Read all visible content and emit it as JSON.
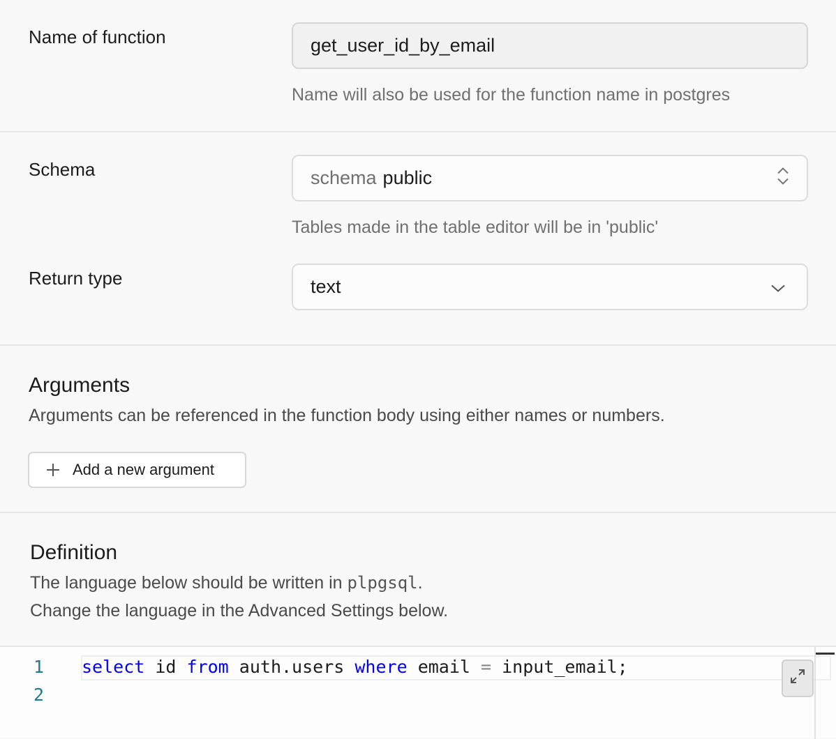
{
  "name_section": {
    "label": "Name of function",
    "value": "get_user_id_by_email",
    "help": "Name will also be used for the function name in postgres"
  },
  "schema_section": {
    "label": "Schema",
    "prefix": "schema",
    "value": "public",
    "help": "Tables made in the table editor will be in 'public'"
  },
  "return_section": {
    "label": "Return type",
    "value": "text"
  },
  "arguments": {
    "title": "Arguments",
    "description": "Arguments can be referenced in the function body using either names or numbers.",
    "add_button": "Add a new argument"
  },
  "definition": {
    "title": "Definition",
    "desc_prefix": "The language below should be written in",
    "language": "plpgsql",
    "desc_suffix": ".",
    "desc_line2": "Change the language in the Advanced Settings below."
  },
  "editor": {
    "line_numbers": [
      "1",
      "2"
    ],
    "tokens": {
      "t1": "select",
      "t2": " id ",
      "t3": "from",
      "t4": " auth.users ",
      "t5": "where",
      "t6": " email ",
      "t7": "=",
      "t8": " input_email;"
    }
  },
  "icons": {
    "schema_select": "chevron-up-down-icon",
    "return_select": "chevron-down-icon",
    "add_button": "plus-icon",
    "expand": "expand-icon"
  }
}
